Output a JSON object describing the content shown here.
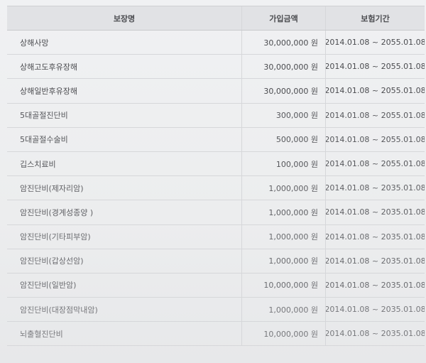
{
  "table": {
    "headers": {
      "name": "보장명",
      "amount": "가입금액",
      "period": "보험기간"
    },
    "rows": [
      {
        "name": "상해사망",
        "amount": "30,000,000 원",
        "period": "2014.01.08 ~ 2055.01.08"
      },
      {
        "name": "상해고도후유장해",
        "amount": "30,000,000 원",
        "period": "2014.01.08 ~ 2055.01.08"
      },
      {
        "name": "상해일반후유장해",
        "amount": "30,000,000 원",
        "period": "2014.01.08 ~ 2055.01.08"
      },
      {
        "name": "5대골절진단비",
        "amount": "300,000 원",
        "period": "2014.01.08 ~ 2055.01.08"
      },
      {
        "name": "5대골절수술비",
        "amount": "500,000 원",
        "period": "2014.01.08 ~ 2055.01.08"
      },
      {
        "name": "깁스치료비",
        "amount": "100,000 원",
        "period": "2014.01.08 ~ 2055.01.08"
      },
      {
        "name": "암진단비(제자리암)",
        "amount": "1,000,000 원",
        "period": "2014.01.08 ~ 2035.01.08"
      },
      {
        "name": "암진단비(경계성종양 )",
        "amount": "1,000,000 원",
        "period": "2014.01.08 ~ 2035.01.08"
      },
      {
        "name": "암진단비(기타피부암)",
        "amount": "1,000,000 원",
        "period": "2014.01.08 ~ 2035.01.08"
      },
      {
        "name": "암진단비(갑상선암)",
        "amount": "1,000,000 원",
        "period": "2014.01.08 ~ 2035.01.08"
      },
      {
        "name": "암진단비(일반암)",
        "amount": "10,000,000 원",
        "period": "2014.01.08 ~ 2035.01.08"
      },
      {
        "name": "암진단비(대장점막내암)",
        "amount": "1,000,000 원",
        "period": "2014.01.08 ~ 2035.01.08"
      },
      {
        "name": "뇌출혈진단비",
        "amount": "10,000,000 원",
        "period": "2014.01.08 ~ 2035.01.08"
      }
    ]
  }
}
